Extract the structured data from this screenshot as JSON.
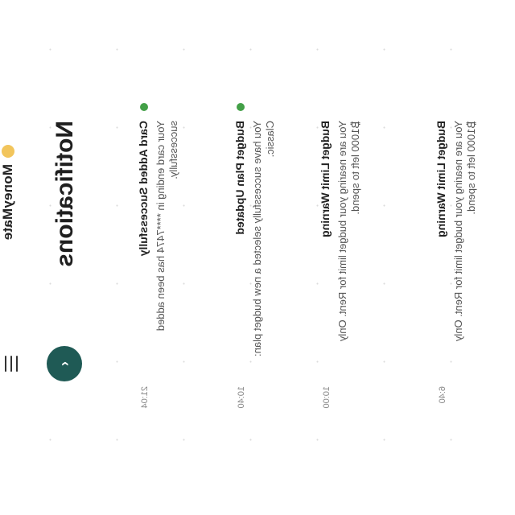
{
  "app": {
    "brand": "MoneyMate"
  },
  "page": {
    "title": "Notifications",
    "back_icon": "‹"
  },
  "notifications": [
    {
      "title": "Card Added Successfully",
      "body": "Your card ending in ****7474 has been added successfully.",
      "time": "21:04",
      "unread": true
    },
    {
      "title": "Budget Plan Updated",
      "body": "You have successfully selected a new budget plan: Classic.",
      "time": "10:40",
      "unread": true
    },
    {
      "title": "Budget Limit Warning",
      "body": "You are nearing your budget limit for Rent. Only ₿1000 left to spend.",
      "time": "10:00",
      "unread": false
    },
    {
      "title": "Budget Limit Warning",
      "body": "You are nearing your budget limit for Rent. Only ₿1000 left to spend.",
      "time": "6:40",
      "unread": false
    }
  ],
  "colors": {
    "accent": "#1f5a55",
    "unread_dot": "#43a047",
    "logo": "#f2c55c"
  }
}
